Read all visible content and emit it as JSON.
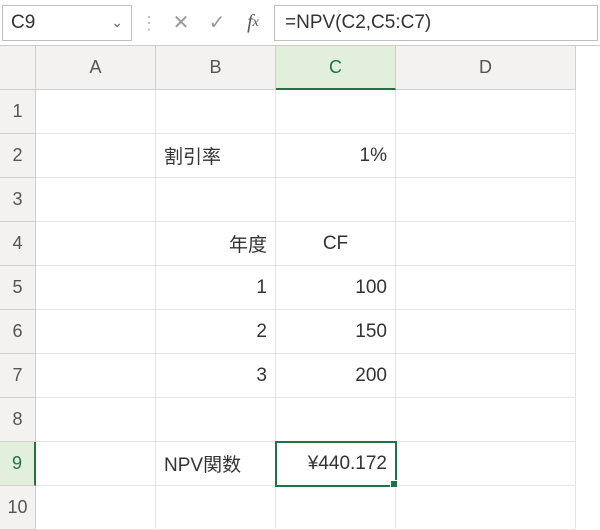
{
  "formula_bar": {
    "name_box": "C9",
    "formula": "=NPV(C2,C5:C7)"
  },
  "columns": [
    "A",
    "B",
    "C",
    "D"
  ],
  "rows_visible": [
    "1",
    "2",
    "3",
    "4",
    "5",
    "6",
    "7",
    "8",
    "9",
    "10"
  ],
  "active_cell": "C9",
  "cells": {
    "B2": "割引率",
    "C2": "1%",
    "B4": "年度",
    "C4": "CF",
    "B5": "1",
    "C5": "100",
    "B6": "2",
    "C6": "150",
    "B7": "3",
    "C7": "200",
    "B9": "NPV関数",
    "C9": "¥440.172"
  },
  "chart_data": {
    "type": "table",
    "title": "NPV calculation",
    "discount_rate": 0.01,
    "series": [
      {
        "year": 1,
        "cf": 100
      },
      {
        "year": 2,
        "cf": 150
      },
      {
        "year": 3,
        "cf": 200
      }
    ],
    "npv_result": 440.172
  }
}
